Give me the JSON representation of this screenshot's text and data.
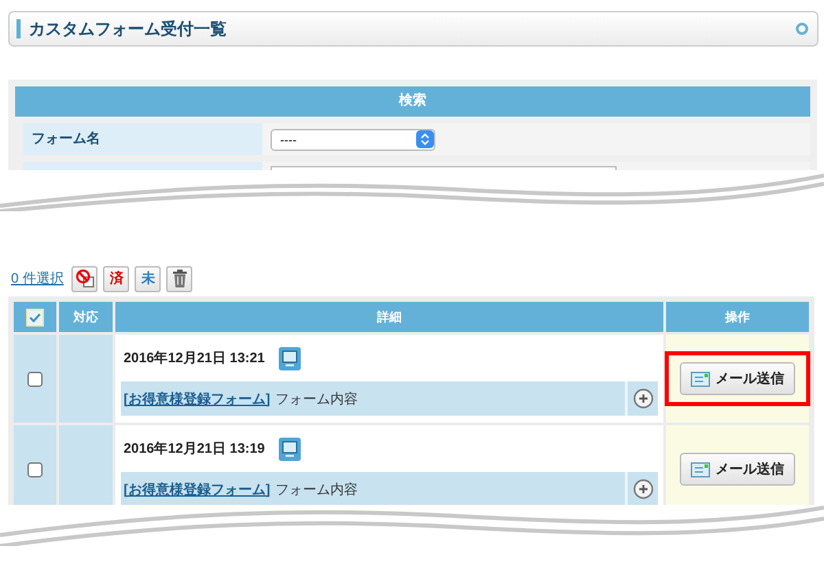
{
  "page_title": "カスタムフォーム受付一覧",
  "search": {
    "title": "検索",
    "fields": [
      {
        "label": "フォーム名",
        "value": "----"
      }
    ]
  },
  "toolbar": {
    "selection_count": "0 件選択",
    "buttons": [
      {
        "kind": "clear"
      },
      {
        "kind": "text",
        "label": "済",
        "color": "#e00000"
      },
      {
        "kind": "text",
        "label": "未",
        "color": "#2a7fc0"
      },
      {
        "kind": "delete"
      }
    ]
  },
  "table": {
    "select_all_checked": true,
    "columns": [
      "対応",
      "詳細",
      "操作"
    ],
    "rows": [
      {
        "checked": false,
        "date": "2016年12月21日 13:21",
        "form_name": "[お得意様登録フォーム]",
        "form_suffix": "フォーム内容",
        "action": "メール送信",
        "highlighted": true
      },
      {
        "checked": false,
        "date": "2016年12月21日 13:19",
        "form_name": "[お得意様登録フォーム]",
        "form_suffix": "フォーム内容",
        "action": "メール送信",
        "highlighted": false
      }
    ]
  }
}
